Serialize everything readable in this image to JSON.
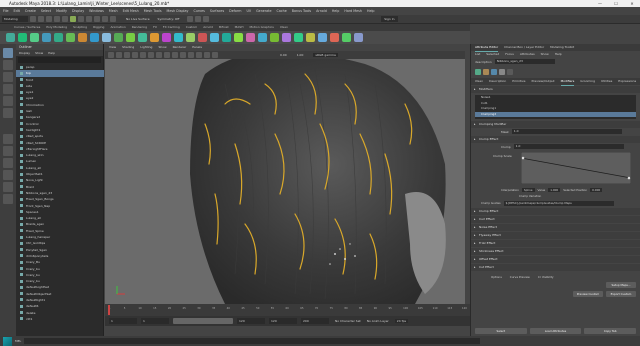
{
  "window": {
    "title": "Autodesk Maya 2018.3: L:\\Lulang_Lamin\\Ji_Winter_Lee\\scenes\\5_Lulang_20.mb*",
    "min": "—",
    "max": "☐",
    "close": "✕"
  },
  "menubar": [
    "File",
    "Edit",
    "Create",
    "Select",
    "Modify",
    "Display",
    "Windows",
    "Mesh",
    "Edit Mesh",
    "Mesh Tools",
    "Mesh Display",
    "Curves",
    "Surfaces",
    "Deform",
    "UV",
    "Generate",
    "Cache",
    "Bonus Tools",
    "Arnold",
    "Help",
    "Hard Mesh",
    "Help"
  ],
  "statusline": {
    "mode": "Modeling",
    "surface": "No Live Surface",
    "symmetry": "Symmetry: Off",
    "signin": "Sign In"
  },
  "shelf_tabs": [
    "Curves / Surfaces",
    "Poly Modeling",
    "Sculpting",
    "Rigging",
    "Animation",
    "Rendering",
    "FX",
    "FX Caching",
    "Custom",
    "Arnold",
    "Bifrost",
    "MASH",
    "Motion Graphics",
    "XGen"
  ],
  "outliner": {
    "title": "Outliner",
    "menus": [
      "Display",
      "Show",
      "Help"
    ],
    "items": [
      "persp",
      "top",
      "front",
      "side",
      "eye1",
      "eye2",
      "Chromatron",
      "lash",
      "bangers2",
      "Ccontrol",
      "hairlight1",
      "cRed_spots",
      "cRed_SCROIE",
      "cEarLightFlare",
      "Lulang_skin",
      "Lumen",
      "Lulang_all",
      "ObjectSet1",
      "Nova_Light",
      "Braid",
      "Nibbons_sgen_23",
      "Fixed_Sgen_Bongs",
      "Front_Sgen_Nep",
      "Spaces1",
      "Lulang_all",
      "Braids_sgen",
      "Fixed_Spine",
      "Lulang_hairaper",
      "Ctrl_Goldtips",
      "Ponytail_Sgen",
      "dirIn6ponytails",
      "Crazy_Bu",
      "Crazy_bu",
      "Crazy_bu",
      "Crazy_bu",
      "defaultLightSet",
      "defaultObjectSet",
      "defaultlight1",
      "default6",
      "delete",
      "clit1"
    ],
    "selected_index": 1
  },
  "viewport": {
    "menus": [
      "View",
      "Shading",
      "Lighting",
      "Show",
      "Renderer",
      "Panels"
    ],
    "srgb": "sRGB gamma",
    "exposure": "0.00",
    "gamma": "1.00"
  },
  "timeline": {
    "ticks": [
      "1",
      "5",
      "10",
      "15",
      "20",
      "25",
      "30",
      "35",
      "40",
      "45",
      "50",
      "55",
      "60",
      "65",
      "70",
      "75",
      "80",
      "85",
      "90",
      "95",
      "100",
      "105",
      "110",
      "115",
      "120"
    ],
    "current": "1"
  },
  "range": {
    "start": "1",
    "inner_start": "1",
    "inner_end": "120",
    "end": "120",
    "end2": "200",
    "fps": "24 fps",
    "character": "No Character Set",
    "anim_layer": "No Anim Layer"
  },
  "cmdline": {
    "label": "MEL"
  },
  "attr_editor": {
    "tabs": [
      "Attribute Editor",
      "Channel Box / Layer Editor",
      "Modeling Toolkit"
    ],
    "menus": [
      "List",
      "Selected",
      "Focus",
      "Attributes",
      "Show",
      "Help"
    ],
    "object_label": "description",
    "object_value": "Nibbons_sgen_23",
    "node_tabs": [
      "XGen",
      "Description",
      "Primitive",
      "Preview/Output",
      "Modifiers",
      "Grooming",
      "Utilities",
      "Expressions"
    ],
    "active_node_tab": "Modifiers",
    "modifiers_header": "Modifiers",
    "modifier_list": [
      "Noise1",
      "Cut1",
      "Clumping1",
      "Clumping2"
    ],
    "selected_modifier": "Clumping2",
    "clumping_header": "Clumping Modifier",
    "mask_label": "Mask",
    "mask_value": "1.0",
    "clump_effect_header": "Clump Effect",
    "clump_label": "Clump",
    "clump_value": "1.0",
    "clump_scale_label": "Clump Scale",
    "interp_label": "Interpolation",
    "interp_value": "Spline",
    "value_label": "Value",
    "value_value": "1.000",
    "pos_label": "Selected Position",
    "pos_value": "0.000",
    "variation_label": "Clump Variation",
    "guides_label": "Clump Guides",
    "guides_value": "${DESC}/paintmaps/clumpGuides/Clump Maps",
    "sections": [
      "Clump Effect",
      "Curl Effect",
      "Noise Effect",
      "Flyaway Effect",
      "Frizz Effect",
      "Stickiness Effect",
      "Offset Effect",
      "Cut Effect"
    ],
    "footer_toggles": [
      "Options",
      "Curve Preview",
      "Cr Visibility"
    ],
    "buttons": [
      "Setup Maps...",
      "Preview Custom",
      "Export Custom"
    ],
    "bottom_buttons": [
      "Select",
      "Load Attributes",
      "Copy Tab"
    ]
  }
}
